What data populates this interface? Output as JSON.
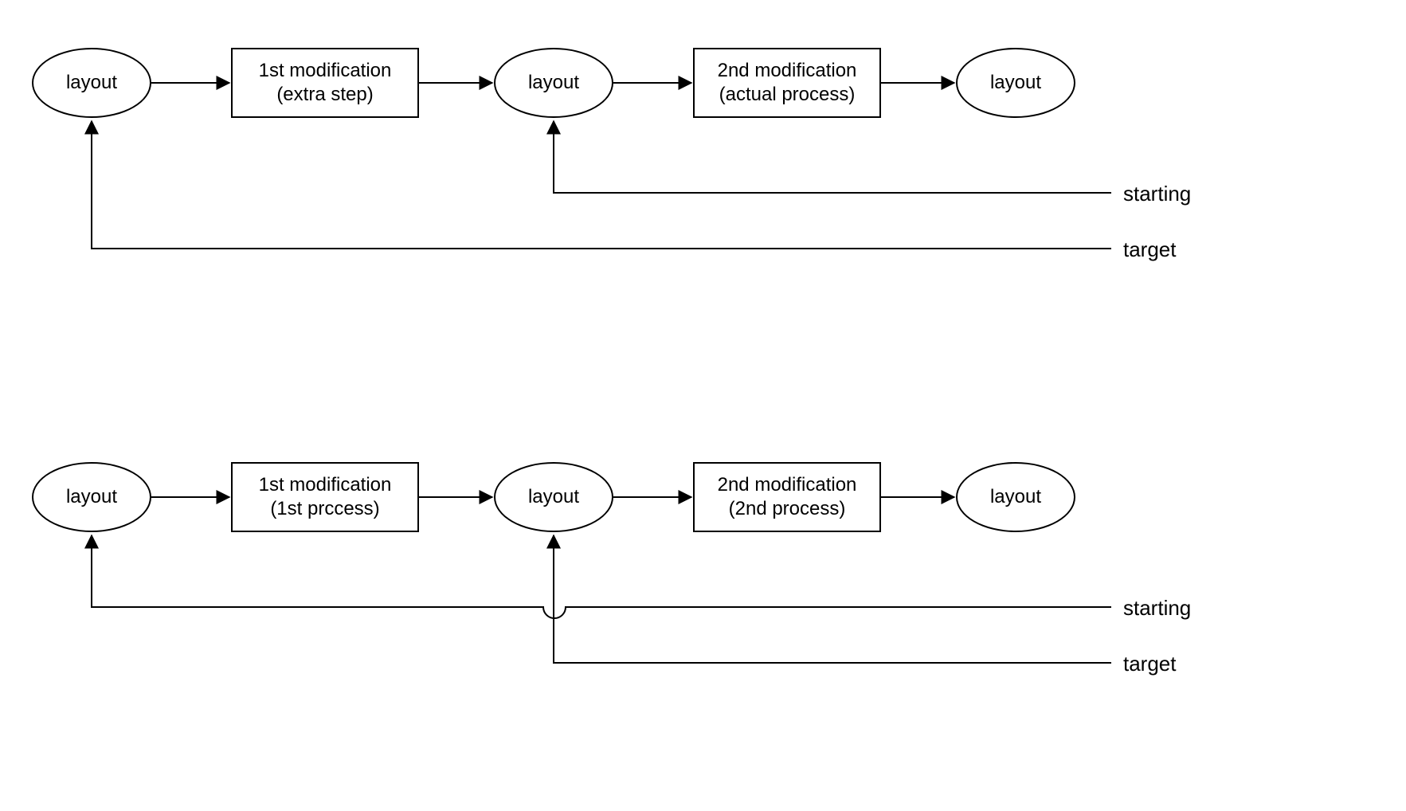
{
  "diagram": {
    "flow1": {
      "node1": "layout",
      "box1_line1": "1st modification",
      "box1_line2": "(extra step)",
      "node2": "layout",
      "box2_line1": "2nd modification",
      "box2_line2": "(actual process)",
      "node3": "layout",
      "label_starting": "starting",
      "label_target": "target"
    },
    "flow2": {
      "node1": "layout",
      "box1_line1": "1st modification",
      "box1_line2": "(1st prccess)",
      "node2": "layout",
      "box2_line1": "2nd modification",
      "box2_line2": "(2nd process)",
      "node3": "layout",
      "label_starting": "starting",
      "label_target": "target"
    }
  }
}
